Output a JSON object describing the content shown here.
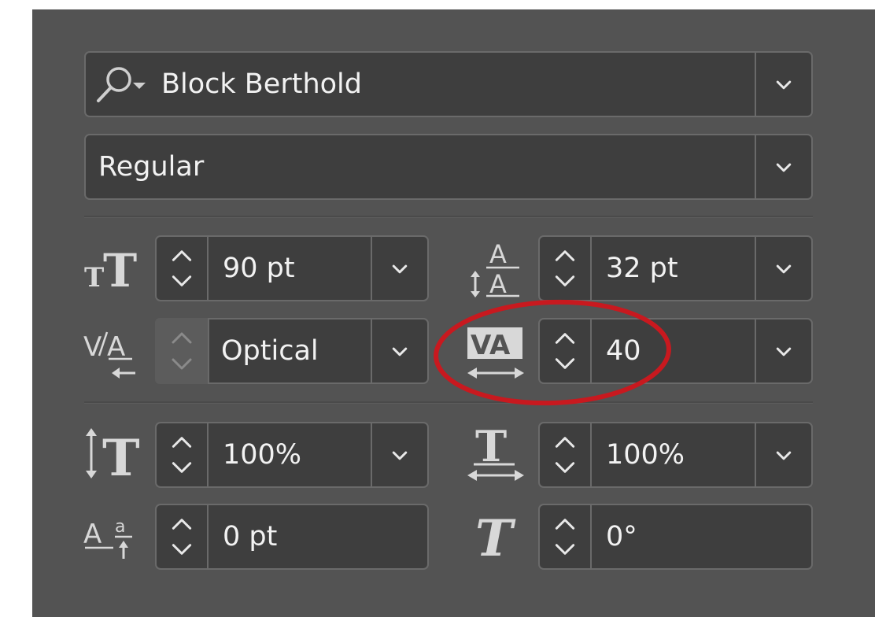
{
  "font": {
    "family_value": "Block Berthold",
    "style_value": "Regular"
  },
  "metrics": {
    "font_size": {
      "value": "90 pt"
    },
    "leading": {
      "value": "32 pt"
    },
    "kerning": {
      "value": "Optical"
    },
    "tracking": {
      "value": "40"
    },
    "vertical_scale": {
      "value": "100%"
    },
    "horizontal_scale": {
      "value": "100%"
    },
    "baseline_shift": {
      "value": "0 pt"
    },
    "skew": {
      "value": "0°"
    }
  },
  "icons": {
    "search": "search-dropdown-icon",
    "font_size": "font-size-icon",
    "leading": "leading-icon",
    "kerning": "kerning-icon",
    "tracking": "tracking-icon",
    "vertical_scale": "vertical-scale-icon",
    "horizontal_scale": "horizontal-scale-icon",
    "baseline_shift": "baseline-shift-icon",
    "skew": "skew-icon"
  },
  "colors": {
    "panel": "#535353",
    "field": "#3e3e3e",
    "border": "#6a6a6a",
    "text": "#f2f2f2",
    "annotation": "#c8191f"
  }
}
